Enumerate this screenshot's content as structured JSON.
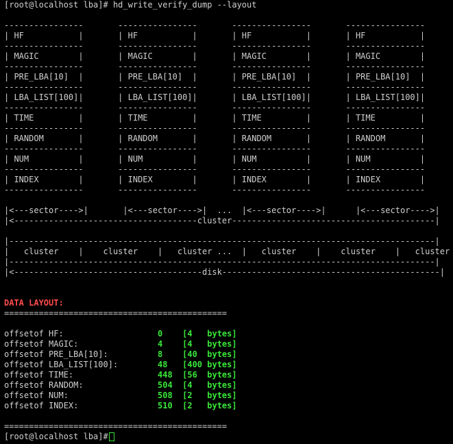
{
  "terminal": {
    "prompt": "[root@localhost lba]# ",
    "command": "hd_write_verify_dump --layout",
    "layout_lines": [
      "----------------       ----------------       ----------------       ----------------",
      "| HF           |       | HF           |       | HF           |       | HF           |",
      "----------------       ----------------       ----------------       ----------------",
      "| MAGIC        |       | MAGIC        |       | MAGIC        |       | MAGIC        |",
      "----------------       ----------------       ----------------       ----------------",
      "| PRE_LBA[10]  |       | PRE_LBA[10]  |       | PRE_LBA[10]  |       | PRE_LBA[10]  |",
      "----------------       ----------------       ----------------       ----------------",
      "| LBA_LIST[100]|       | LBA_LIST[100]|       | LBA_LIST[100]|       | LBA_LIST[100]|",
      "----------------       ----------------       ----------------       ----------------",
      "| TIME         |       | TIME         |       | TIME         |       | TIME         |",
      "----------------       ----------------       ----------------       ----------------",
      "| RANDOM       |       | RANDOM       |       | RANDOM       |       | RANDOM       |",
      "----------------       ----------------       ----------------       ----------------",
      "| NUM          |       | NUM          |       | NUM          |       | NUM          |",
      "----------------       ----------------       ----------------       ----------------",
      "| INDEX        |       | INDEX        |       | INDEX        |       | INDEX        |",
      "----------------       ----------------       ----------------       ----------------",
      "",
      "|<---sector---->|       |<---sector---->|  ...  |<---sector---->|      |<---sector---->|",
      "|<-------------------------------------cluster-----------------------------------------|",
      "",
      "|--------------------------------------------------------------------------------------|",
      "|   cluster    |    cluster    |   cluster ...  |   cluster    |    cluster    |   cluster   |",
      "|--------------------------------------------------------------------------------------|",
      "|<--------------------------------------disk--------------------------------------------|"
    ],
    "data_layout_title": "DATA LAYOUT:",
    "separator": "=============================================",
    "offsets": [
      {
        "label": "offsetof HF:",
        "value": "0    [4   bytes]"
      },
      {
        "label": "offsetof MAGIC:",
        "value": "4    [4   bytes]"
      },
      {
        "label": "offsetof PRE_LBA[10]:",
        "value": "8    [40  bytes]"
      },
      {
        "label": "offsetof LBA_LIST[100]:",
        "value": "48   [400 bytes]"
      },
      {
        "label": "offsetof TIME:",
        "value": "448  [56  bytes]"
      },
      {
        "label": "offsetof RANDOM:",
        "value": "504  [4   bytes]"
      },
      {
        "label": "offsetof NUM:",
        "value": "508  [2   bytes]"
      },
      {
        "label": "offsetof INDEX:",
        "value": "510  [2   bytes]"
      }
    ],
    "final_prompt": "[root@localhost lba]# "
  },
  "colors": {
    "background": "#000000",
    "text": "#d0d0d0",
    "heading": "#ff4b4b",
    "value": "#39e639"
  }
}
